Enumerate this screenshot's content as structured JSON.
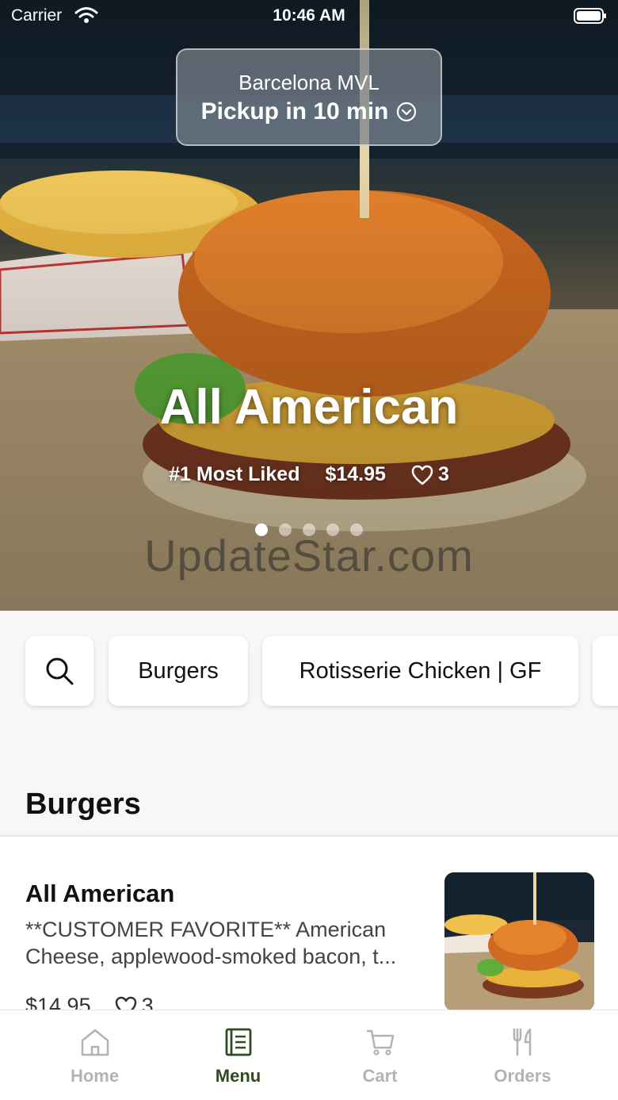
{
  "status_bar": {
    "carrier": "Carrier",
    "time": "10:46 AM"
  },
  "location": {
    "name": "Barcelona MVL",
    "pickup": "Pickup in 10 min"
  },
  "hero": {
    "title": "All American",
    "rank": "#1 Most Liked",
    "price": "$14.95",
    "likes": "3",
    "slide_count": 5,
    "active_slide": 1
  },
  "watermark": "UpdateStar.com",
  "categories": {
    "items": [
      "Burgers",
      "Rotisserie Chicken | GF"
    ]
  },
  "section": {
    "title": "Burgers"
  },
  "menu_item": {
    "name": "All American",
    "desc_line1": "**CUSTOMER FAVORITE** American",
    "desc_line2": "Cheese, applewood-smoked bacon, t...",
    "price": "$14.95",
    "likes": "3"
  },
  "tabbar": {
    "tabs": [
      "Home",
      "Menu",
      "Cart",
      "Orders"
    ],
    "active": "Menu"
  },
  "colors": {
    "accent": "#2f4b1f",
    "inactive": "#b3b3b3"
  }
}
